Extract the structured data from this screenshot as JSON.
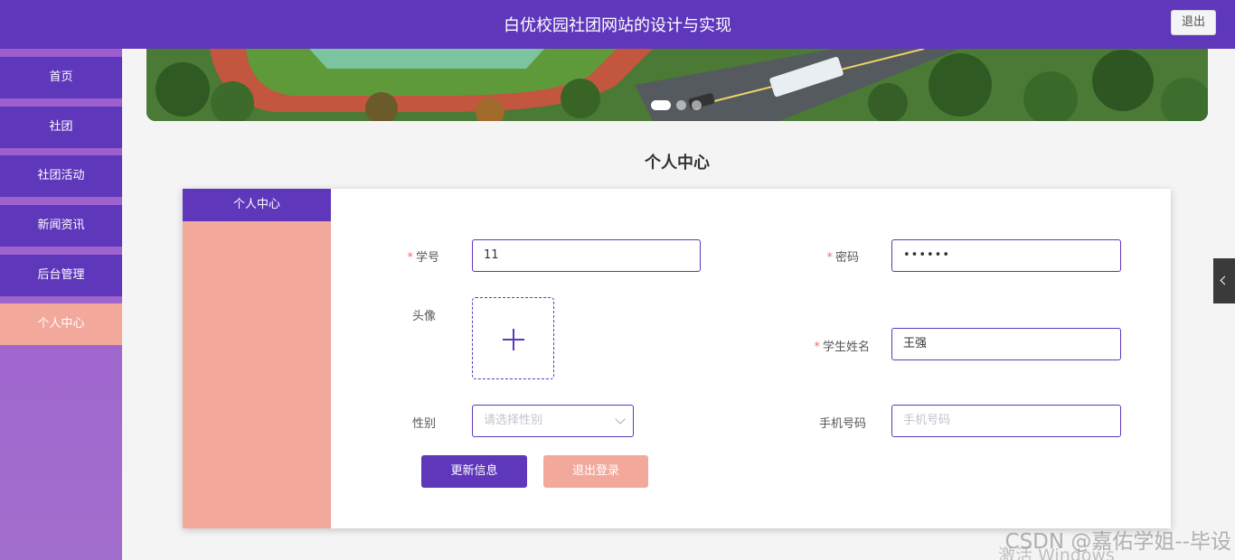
{
  "header": {
    "title": "白优校园社团网站的设计与实现",
    "logout_label": "退出"
  },
  "sidebar": {
    "items": [
      {
        "label": "首页"
      },
      {
        "label": "社团"
      },
      {
        "label": "社团活动"
      },
      {
        "label": "新闻资讯"
      },
      {
        "label": "后台管理"
      },
      {
        "label": "个人中心",
        "active": true
      }
    ]
  },
  "carousel": {
    "slide_count": 3,
    "active_index": 0
  },
  "page_title": "个人中心",
  "profile": {
    "tab_label": "个人中心",
    "fields": {
      "student_id": {
        "label": "学号",
        "value": "11",
        "required": true
      },
      "password": {
        "label": "密码",
        "value": "••••••",
        "required": true
      },
      "avatar": {
        "label": "头像"
      },
      "student_name": {
        "label": "学生姓名",
        "value": "王强",
        "required": true
      },
      "gender": {
        "label": "性别",
        "placeholder": "请选择性别"
      },
      "phone": {
        "label": "手机号码",
        "placeholder": "手机号码"
      }
    },
    "update_button": "更新信息",
    "logout_button": "退出登录"
  },
  "watermarks": {
    "csdn": "CSDN @嘉佑学姐--毕设",
    "windows": "激活 Windows"
  },
  "colors": {
    "primary": "#5e37bb",
    "accent": "#f2a99c",
    "required": "#f56c6c"
  }
}
